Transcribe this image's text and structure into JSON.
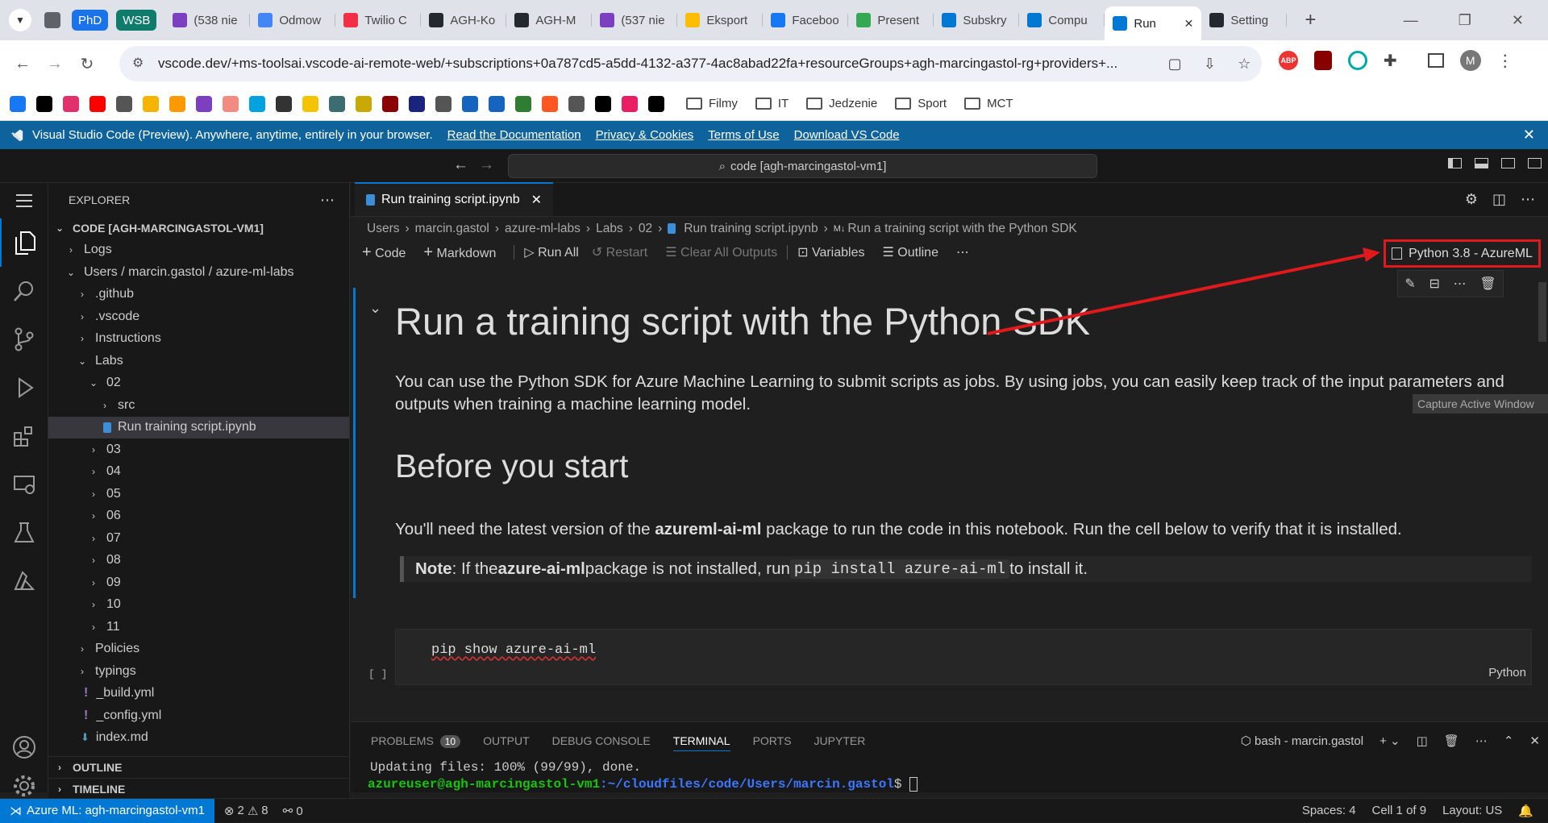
{
  "browser": {
    "tabs": [
      {
        "title": "PhD",
        "color": "#1a73e8",
        "kind": "group"
      },
      {
        "title": "WSB",
        "color": "#0f7b6c",
        "kind": "group"
      },
      {
        "title": "(538 nie",
        "color": "#7b3fbf"
      },
      {
        "title": "Odmow",
        "color": "#4285f4"
      },
      {
        "title": "Twilio C",
        "color": "#f22f46"
      },
      {
        "title": "AGH-Ko",
        "color": "#24292f"
      },
      {
        "title": "AGH-M",
        "color": "#24292f"
      },
      {
        "title": "(537 nie",
        "color": "#7b3fbf"
      },
      {
        "title": "Eksport",
        "color": "#fbbc04"
      },
      {
        "title": "Faceboo",
        "color": "#1877f2"
      },
      {
        "title": "Present",
        "color": "#34a853"
      },
      {
        "title": "Subskry",
        "color": "#0078d4"
      },
      {
        "title": "Compu",
        "color": "#0078d4"
      },
      {
        "title": "Run",
        "color": "#0078d4",
        "active": true
      },
      {
        "title": "Setting",
        "color": "#24292f"
      }
    ],
    "url": "vscode.dev/+ms-toolsai.vscode-ai-remote-web/+subscriptions+0a787cd5-a5dd-4132-a377-4ac8abad22fa+resourceGroups+agh-marcingastol-rg+providers+...",
    "profile_initial": "M",
    "bookmark_folders": [
      "Filmy",
      "IT",
      "Jedzenie",
      "Sport",
      "MCT"
    ],
    "bookmark_icons": [
      "#1877f2",
      "#000000",
      "#e1306c",
      "#ff0000",
      "#555555",
      "#f4b400",
      "#ff9900",
      "#7b3fbf",
      "#f28b82",
      "#00a3e0",
      "#333333",
      "#f5c400",
      "#3c6e71",
      "#c9a800",
      "#8b0000",
      "#1a237e",
      "#555555",
      "#1565c0",
      "#1565c0",
      "#2e7d32",
      "#ff5722",
      "#555555",
      "#000000",
      "#e91e63",
      "#000000"
    ]
  },
  "banner": {
    "text": "Visual Studio Code (Preview). Anywhere, anytime, entirely in your browser.",
    "links": [
      "Read the Documentation",
      "Privacy & Cookies",
      "Terms of Use",
      "Download VS Code"
    ]
  },
  "command_center": {
    "label": "code [agh-marcingastol-vm1]"
  },
  "explorer": {
    "title": "EXPLORER",
    "root": "CODE [AGH-MARCINGASTOL-VM1]",
    "items": [
      {
        "label": "Logs",
        "depth": 1,
        "expanded": false
      },
      {
        "label": "Users / marcin.gastol / azure-ml-labs",
        "depth": 1,
        "expanded": true
      },
      {
        "label": ".github",
        "depth": 2,
        "expanded": false
      },
      {
        "label": ".vscode",
        "depth": 2,
        "expanded": false
      },
      {
        "label": "Instructions",
        "depth": 2,
        "expanded": false
      },
      {
        "label": "Labs",
        "depth": 2,
        "expanded": true
      },
      {
        "label": "02",
        "depth": 3,
        "expanded": true
      },
      {
        "label": "src",
        "depth": 4,
        "expanded": false
      },
      {
        "label": "Run training script.ipynb",
        "depth": 4,
        "file": "notebook",
        "selected": true
      },
      {
        "label": "03",
        "depth": 3,
        "expanded": false
      },
      {
        "label": "04",
        "depth": 3,
        "expanded": false
      },
      {
        "label": "05",
        "depth": 3,
        "expanded": false
      },
      {
        "label": "06",
        "depth": 3,
        "expanded": false
      },
      {
        "label": "07",
        "depth": 3,
        "expanded": false
      },
      {
        "label": "08",
        "depth": 3,
        "expanded": false
      },
      {
        "label": "09",
        "depth": 3,
        "expanded": false
      },
      {
        "label": "10",
        "depth": 3,
        "expanded": false
      },
      {
        "label": "11",
        "depth": 3,
        "expanded": false
      },
      {
        "label": "Policies",
        "depth": 2,
        "expanded": false
      },
      {
        "label": "typings",
        "depth": 2,
        "expanded": false
      },
      {
        "label": "_build.yml",
        "depth": 2,
        "file": "yml"
      },
      {
        "label": "_config.yml",
        "depth": 2,
        "file": "yml"
      },
      {
        "label": "index.md",
        "depth": 2,
        "file": "md"
      }
    ],
    "outline": "OUTLINE",
    "timeline": "TIMELINE"
  },
  "editor": {
    "tab": "Run training script.ipynb",
    "breadcrumb": [
      "Users",
      "marcin.gastol",
      "azure-ml-labs",
      "Labs",
      "02",
      "Run training script.ipynb",
      "Run a training script with the Python SDK"
    ],
    "toolbar": {
      "code": "Code",
      "markdown": "Markdown",
      "run_all": "Run All",
      "restart": "Restart",
      "clear": "Clear All Outputs",
      "variables": "Variables",
      "outline": "Outline"
    },
    "kernel": "Python 3.8 - AzureML",
    "title": "Run a training script with the Python SDK",
    "intro": "You can use the Python SDK for Azure Machine Learning to submit scripts as jobs. By using jobs, you can easily keep track of the input parameters and outputs when training a machine learning model.",
    "h2": "Before you start",
    "p2_pre": "You'll need the latest version of the ",
    "p2_bold": "azureml-ai-ml",
    "p2_post": " package to run the code in this notebook. Run the cell below to verify that it is installed.",
    "note_label": "Note",
    "note_pre": ": If the ",
    "note_bold": "azure-ai-ml",
    "note_mid": " package is not installed, run ",
    "note_code": "pip install azure-ai-ml",
    "note_post": " to install it.",
    "code_line": "pip show azure-ai-ml",
    "cell_prompt": "[ ]",
    "cell_lang": "Python",
    "tooltip": "Capture Active Window"
  },
  "panel": {
    "tabs": [
      "PROBLEMS",
      "OUTPUT",
      "DEBUG CONSOLE",
      "TERMINAL",
      "PORTS",
      "JUPYTER"
    ],
    "problems_count": "10",
    "terminal_name": "bash - marcin.gastol",
    "line1": "Updating files: 100% (99/99), done.",
    "prompt_user": "azureuser@agh-marcingastol-vm1",
    "prompt_path": ":~/cloudfiles/code/Users/marcin.gastol",
    "prompt_end": "$"
  },
  "status": {
    "remote": "Azure ML: agh-marcingastol-vm1",
    "errors": "2",
    "warnings": "8",
    "ports": "0",
    "spaces": "Spaces: 4",
    "cell": "Cell 1 of 9",
    "layout": "Layout: US"
  },
  "colors": {
    "accent": "#0078d4",
    "annotation": "#e0191c"
  }
}
